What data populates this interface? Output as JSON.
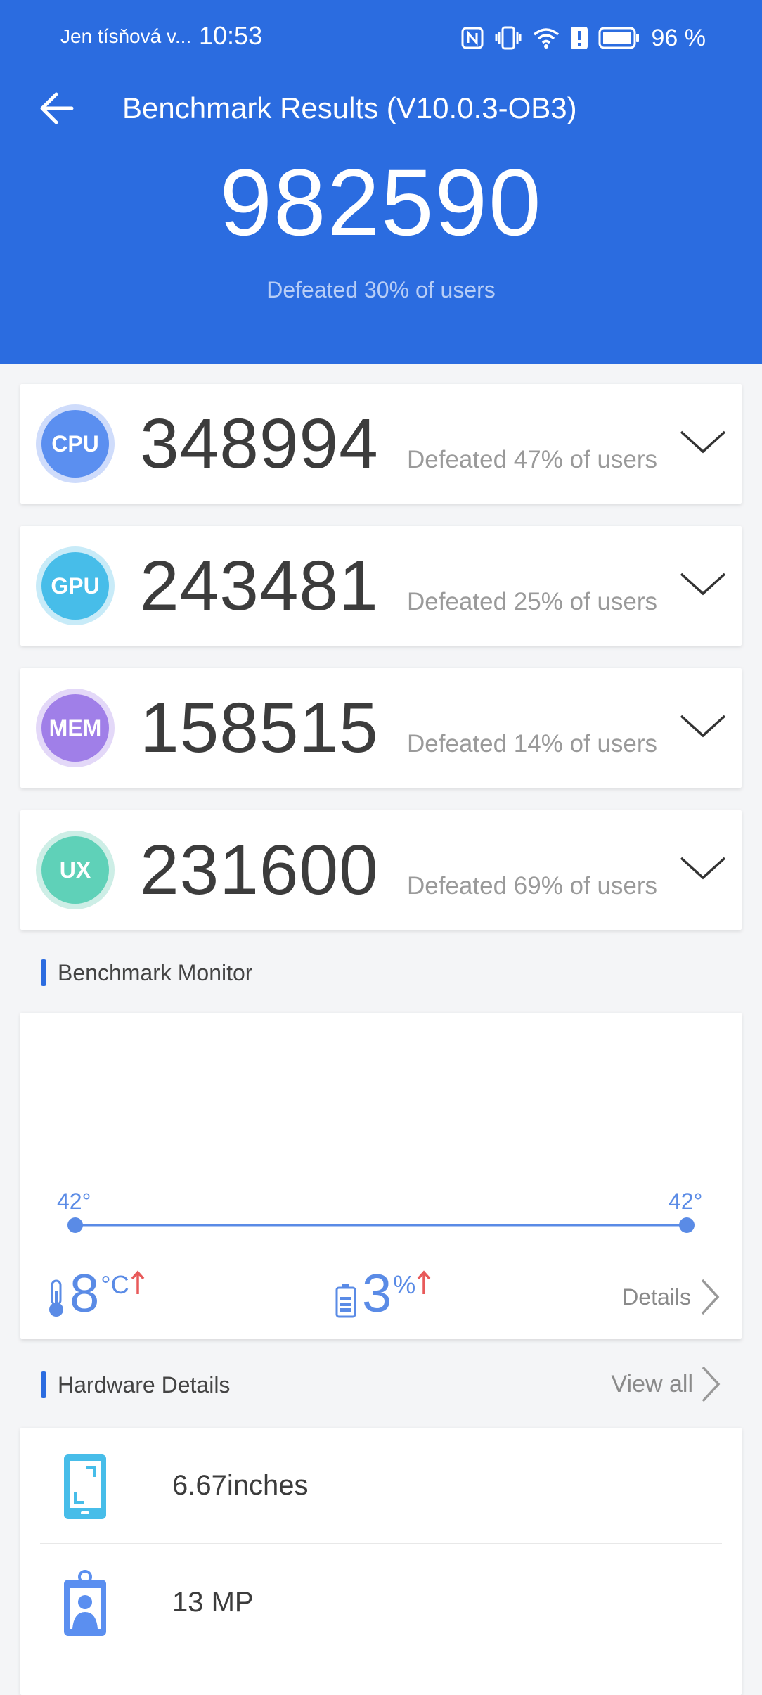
{
  "status_bar": {
    "carrier": "Jen tísňová v...",
    "time": "10:53",
    "battery": "96 %",
    "icons": [
      "nfc-icon",
      "vibrate-icon",
      "wifi-icon",
      "alert-icon",
      "battery-icon"
    ]
  },
  "header": {
    "title": "Benchmark Results (V10.0.3-OB3)",
    "total_score": "982590",
    "total_defeated": "Defeated 30% of users"
  },
  "scores": [
    {
      "label": "CPU",
      "value": "348994",
      "defeated": "Defeated 47% of users",
      "color": "#5b8ff0",
      "ring": "#cfdcfb"
    },
    {
      "label": "GPU",
      "value": "243481",
      "defeated": "Defeated 25% of users",
      "color": "#47bde9",
      "ring": "#c8ebf8"
    },
    {
      "label": "MEM",
      "value": "158515",
      "defeated": "Defeated 14% of users",
      "color": "#a07fe8",
      "ring": "#e3d8f8"
    },
    {
      "label": "UX",
      "value": "231600",
      "defeated": "Defeated 69% of users",
      "color": "#5fd1b8",
      "ring": "#cdeee6"
    }
  ],
  "monitor": {
    "section_title": "Benchmark Monitor",
    "temp_start_label": "42°",
    "temp_end_label": "42°",
    "temp_rise": "8",
    "temp_unit": "°C",
    "battery_drop": "3",
    "battery_unit": "%",
    "details_label": "Details",
    "line_color": "#5a8be6",
    "arrow_color": "#e85a5a"
  },
  "hardware": {
    "section_title": "Hardware Details",
    "view_all_label": "View all",
    "items": [
      {
        "icon": "screen-size-icon",
        "text": "6.67inches"
      },
      {
        "icon": "camera-id-icon",
        "text": "13 MP"
      }
    ]
  }
}
